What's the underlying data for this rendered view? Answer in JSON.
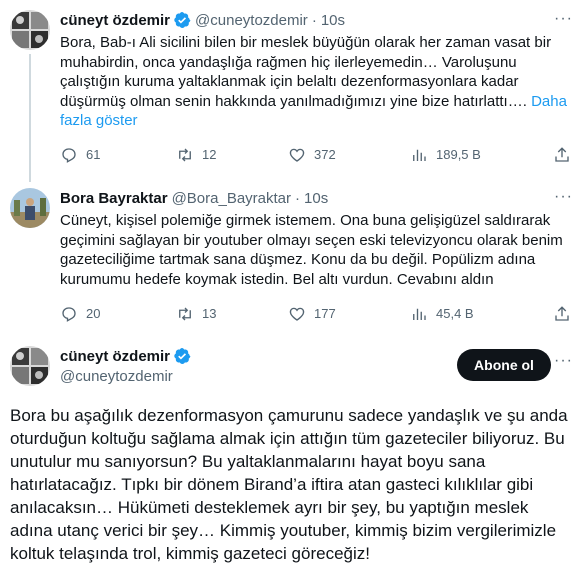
{
  "tweet1": {
    "name": "cüneyt özdemir",
    "handle": "@cuneytozdemir",
    "dot": "·",
    "time": "10s",
    "more": "···",
    "text": "Bora, Bab-ı Ali sicilini bilen bir meslek büyüğün olarak her zaman vasat bir muhabirdin, onca yandaşlığa rağmen hiç ilerleyemedin… Varoluşunu çalıştığın kuruma yaltaklanmak için belaltı dezenformasyonlara kadar düşürmüş olman senin hakkında yanılmadığımızı yine bize hatırlattı…. ",
    "show_more": "Daha fazla göster",
    "replies": "61",
    "retweets": "12",
    "likes": "372",
    "views": "189,5 B"
  },
  "tweet2": {
    "name": "Bora Bayraktar",
    "handle": "@Bora_Bayraktar",
    "dot": "·",
    "time": "10s",
    "more": "···",
    "text": "Cüneyt, kişisel polemiğe girmek istemem. Ona buna gelişigüzel saldırarak geçimini sağlayan bir youtuber olmayı seçen eski televizyoncu olarak benim gazeteciliğime tartmak sana düşmez. Konu da bu değil. Popülizm adına kurumumu hedefe koymak istedin. Bel altı vurdun. Cevabını aldın",
    "replies": "20",
    "retweets": "13",
    "likes": "177",
    "views": "45,4 B"
  },
  "tweet3": {
    "name": "cüneyt özdemir",
    "handle": "@cuneytozdemir",
    "follow_label": "Abone ol",
    "more": "···",
    "text": "Bora bu aşağılık dezenformasyon çamurunu sadece yandaşlık ve şu anda oturduğun koltuğu sağlama almak için attığın tüm gazeteciler biliyoruz. Bu unutulur mu sanıyorsun? Bu yaltaklanmalarını hayat boyu sana hatırlatacağız. Tıpkı bir dönem Birand’a iftira atan gasteci kılıklılar gibi anılacaksın… Hükümeti desteklemek ayrı bir şey, bu yaptığın meslek adına utanç verici bir şey… Kimmiş youtuber, kimmiş bizim vergilerimizle koltuk telaşında trol, kimmiş gazeteci göreceğiz!"
  },
  "colors": {
    "verified": "#1d9bf0",
    "link": "#1d9bf0",
    "secondary_text": "#536471",
    "thread_line": "#cfd9de",
    "button_bg": "#0f1419"
  },
  "icons": [
    "reply-icon",
    "retweet-icon",
    "like-icon",
    "views-icon",
    "share-icon",
    "verified-badge-icon"
  ]
}
